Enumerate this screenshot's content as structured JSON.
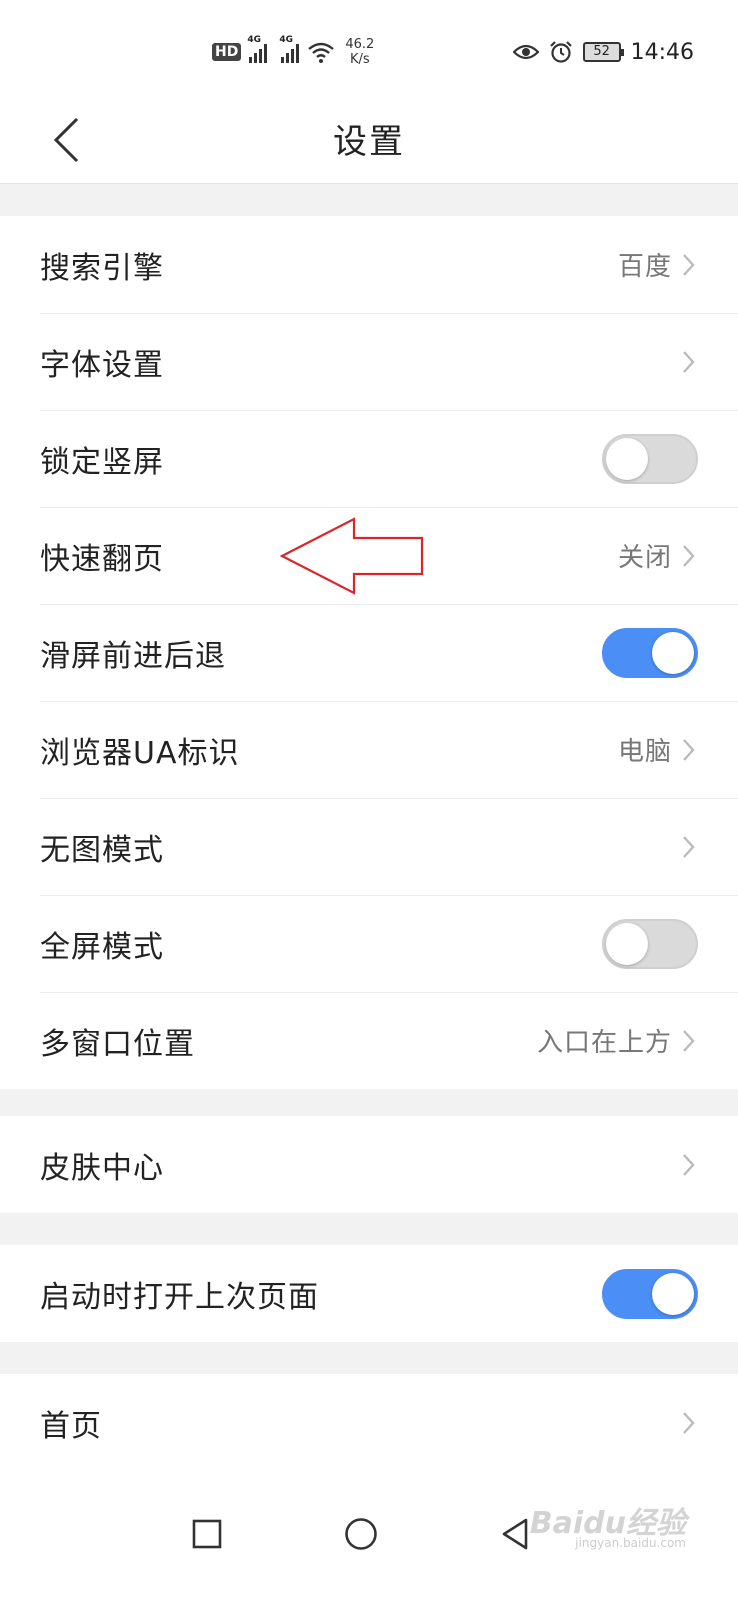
{
  "status_bar": {
    "hd_badge": "HD",
    "signal_1_tag": "4G",
    "signal_2_tag": "4G",
    "net_speed_value": "46.2",
    "net_speed_unit": "K/s",
    "battery_level": "52",
    "clock": "14:46",
    "icons": [
      "hd-icon",
      "signal-icon",
      "signal-icon",
      "wifi-icon",
      "eye-icon",
      "alarm-icon",
      "battery-icon"
    ]
  },
  "header": {
    "title": "设置",
    "back_icon": "chevron-left-icon"
  },
  "groups": [
    {
      "items": [
        {
          "label": "搜索引擎",
          "type": "link",
          "value": "百度"
        },
        {
          "label": "字体设置",
          "type": "link",
          "value": ""
        },
        {
          "label": "锁定竖屏",
          "type": "toggle",
          "on": false
        },
        {
          "label": "快速翻页",
          "type": "link",
          "value": "关闭"
        },
        {
          "label": "滑屏前进后退",
          "type": "toggle",
          "on": true
        },
        {
          "label": "浏览器UA标识",
          "type": "link",
          "value": "电脑"
        },
        {
          "label": "无图模式",
          "type": "link",
          "value": ""
        },
        {
          "label": "全屏模式",
          "type": "toggle",
          "on": false
        },
        {
          "label": "多窗口位置",
          "type": "link",
          "value": "入口在上方"
        }
      ]
    },
    {
      "items": [
        {
          "label": "皮肤中心",
          "type": "link",
          "value": ""
        }
      ]
    },
    {
      "items": [
        {
          "label": "启动时打开上次页面",
          "type": "toggle",
          "on": true
        }
      ]
    },
    {
      "items": [
        {
          "label": "首页",
          "type": "link",
          "value": ""
        }
      ]
    }
  ],
  "colors": {
    "toggle_on": "#4b8ef5",
    "toggle_off": "#dadada",
    "annotation_arrow": "#d9262c"
  },
  "nav_bar": {
    "icons": [
      "recent-apps-icon",
      "home-icon",
      "back-icon"
    ]
  },
  "watermark": {
    "main": "Baidu经验",
    "sub": "jingyan.baidu.com"
  }
}
